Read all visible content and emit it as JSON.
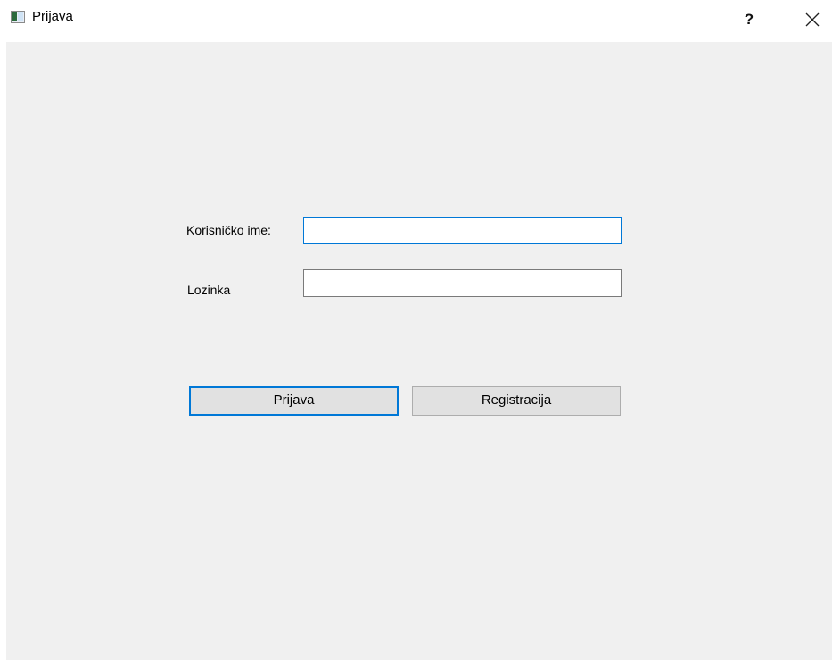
{
  "window": {
    "title": "Prijava",
    "help_glyph": "?",
    "icons": {
      "app": "window-app-icon",
      "close": "close-icon"
    }
  },
  "form": {
    "username_label": "Korisničko ime:",
    "username_value": "",
    "password_label": "Lozinka",
    "password_value": ""
  },
  "buttons": {
    "login_label": "Prijava",
    "register_label": "Registracija"
  },
  "colors": {
    "accent": "#0078d7",
    "client_background": "#f0f0f0",
    "button_face": "#e1e1e1"
  }
}
